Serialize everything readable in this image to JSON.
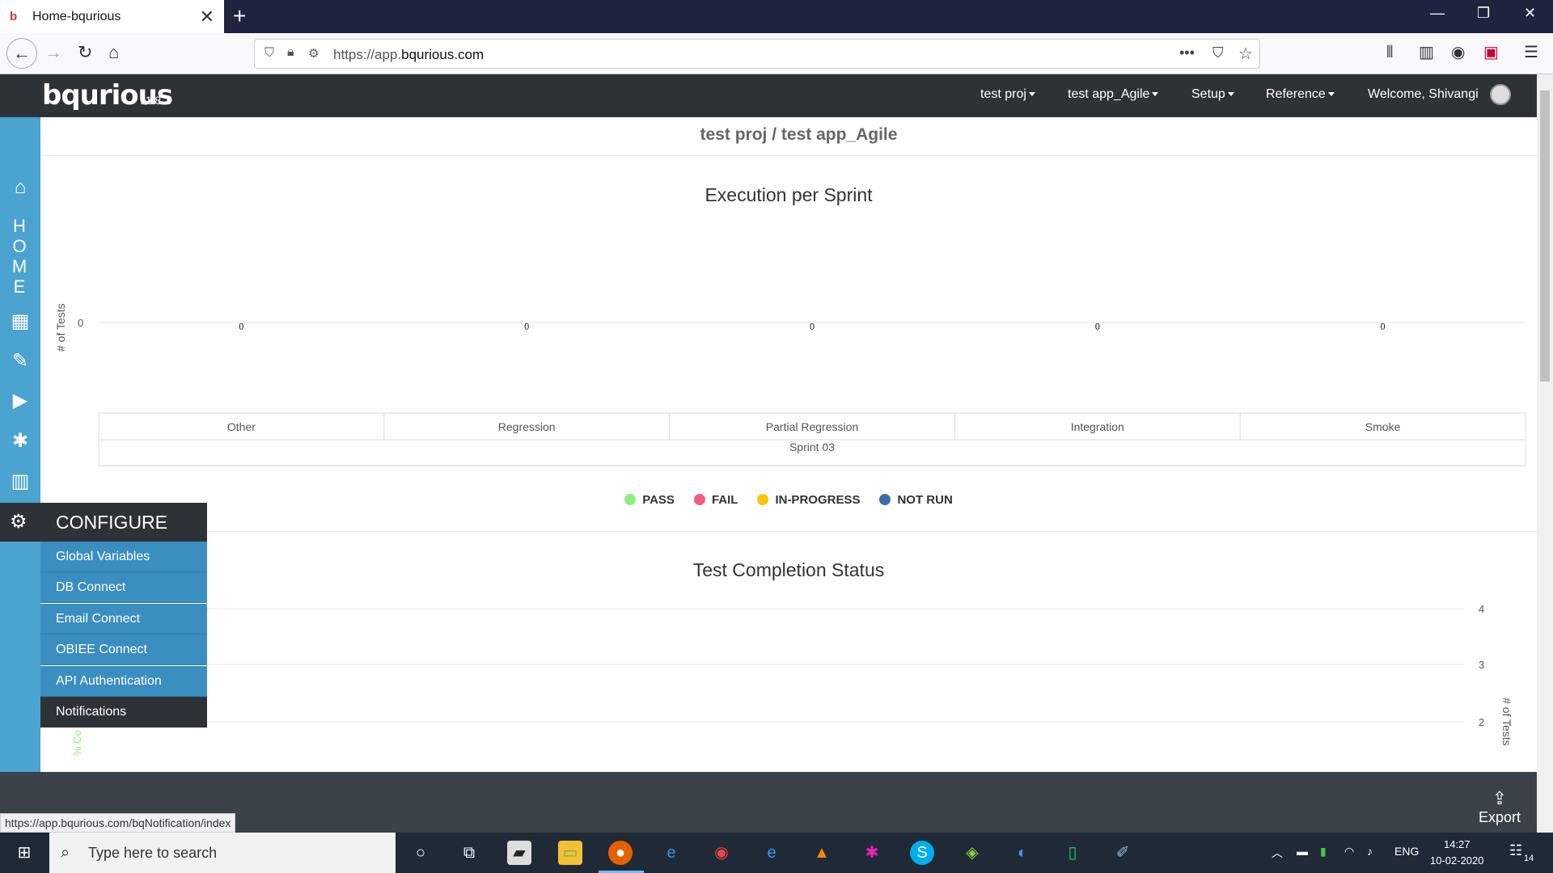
{
  "browser": {
    "tab_title": "Home-bqurious",
    "url_prefix": "https://app.",
    "url_domain": "bqurious.com",
    "status_url": "https://app.bqurious.com/bqNotification/index"
  },
  "app": {
    "logo": "bqurious",
    "version": "11.8.1",
    "menu": {
      "project": "test proj",
      "application": "test app_Agile",
      "setup": "Setup",
      "reference": "Reference",
      "welcome": "Welcome, Shivangi"
    },
    "breadcrumb": "test proj / test app_Agile"
  },
  "sidebar": {
    "home_letters": [
      "H",
      "O",
      "M",
      "E"
    ]
  },
  "configure": {
    "title": "CONFIGURE",
    "items": [
      "Global Variables",
      "DB Connect",
      "Email Connect",
      "OBIEE Connect",
      "API Authentication",
      "Notifications"
    ]
  },
  "legend": {
    "pass": "PASS",
    "fail": "FAIL",
    "in_progress": "IN-PROGRESS",
    "not_run": "NOT RUN"
  },
  "colors": {
    "pass": "#90ed7d",
    "fail": "#f15c80",
    "in_progress": "#f7c50a",
    "not_run": "#3b6ea8"
  },
  "chart_data": [
    {
      "type": "bar",
      "title": "Execution per Sprint",
      "ylabel": "# of Tests",
      "categories": [
        "Other",
        "Regression",
        "Partial Regression",
        "Integration",
        "Smoke"
      ],
      "group_label": "Sprint 03",
      "series": [
        {
          "name": "PASS",
          "values": [
            0,
            0,
            0,
            0,
            0
          ]
        },
        {
          "name": "FAIL",
          "values": [
            0,
            0,
            0,
            0,
            0
          ]
        },
        {
          "name": "IN-PROGRESS",
          "values": [
            0,
            0,
            0,
            0,
            0
          ]
        },
        {
          "name": "NOT RUN",
          "values": [
            0,
            0,
            0,
            0,
            0
          ]
        }
      ],
      "data_labels": [
        "0",
        "0",
        "0",
        "0",
        "0"
      ],
      "yticks": [
        "0"
      ],
      "legend": "bottom"
    },
    {
      "type": "line",
      "title": "Test Completion Status",
      "ylabel_right": "# of Tests",
      "ylabel_left": "% Co",
      "yticks_right": [
        "4",
        "3",
        "2"
      ]
    }
  ],
  "footer": {
    "export": "Export"
  },
  "taskbar": {
    "search_placeholder": "Type here to search",
    "lang": "ENG",
    "time": "14:27",
    "date": "10-02-2020",
    "notifications": "14"
  }
}
